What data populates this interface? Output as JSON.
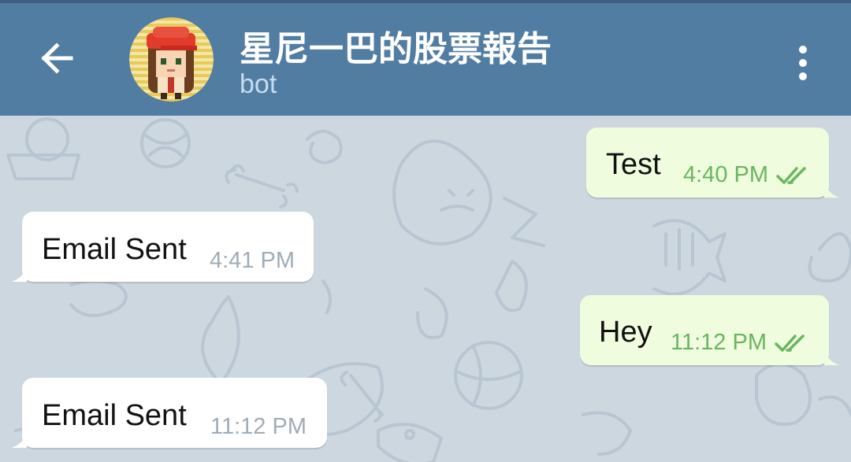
{
  "header": {
    "title": "星尼一巴的股票報告",
    "subtitle": "bot"
  },
  "colors": {
    "appbar": "#527da3",
    "chat_bg": "#cdd7e0",
    "outgoing_bubble": "#effdde",
    "incoming_bubble": "#ffffff",
    "outgoing_meta": "#6ab561",
    "incoming_meta": "#a0acb6"
  },
  "icons": {
    "back": "arrow-left-icon",
    "menu": "more-vertical-icon",
    "read": "double-check-icon"
  },
  "messages": [
    {
      "direction": "outgoing",
      "text": "Test",
      "time": "4:40 PM",
      "status": "read"
    },
    {
      "direction": "incoming",
      "text": "Email Sent",
      "time": "4:41 PM"
    },
    {
      "direction": "outgoing",
      "text": "Hey",
      "time": "11:12 PM",
      "status": "read"
    },
    {
      "direction": "incoming",
      "text": "Email Sent",
      "time": "11:12 PM"
    }
  ]
}
